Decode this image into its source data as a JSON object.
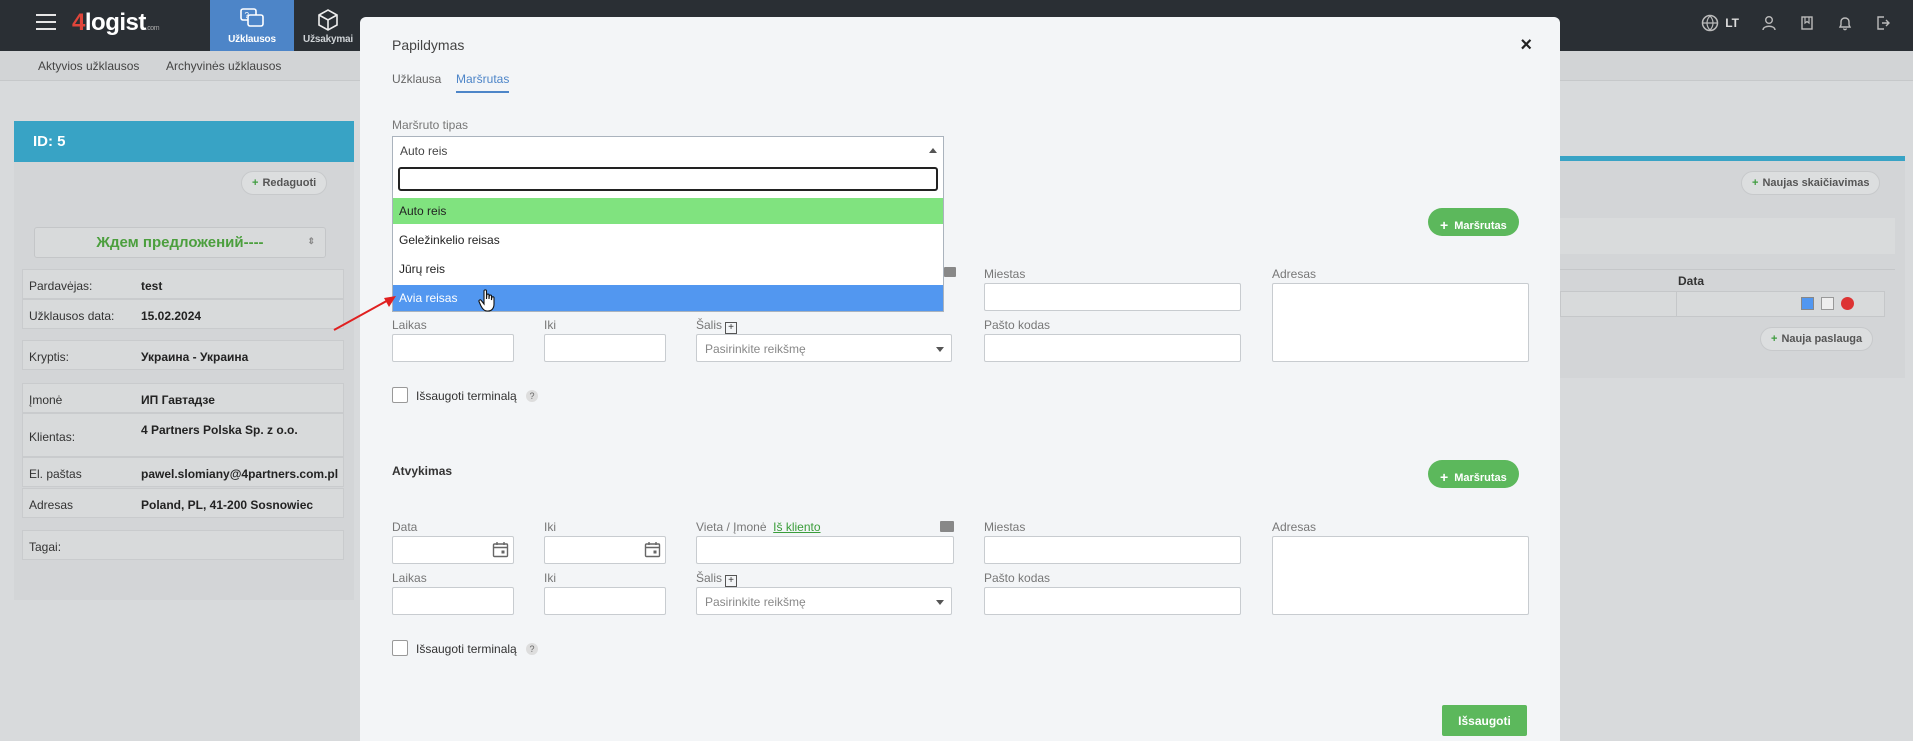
{
  "topbar": {
    "logo_prefix": "4",
    "logo_text": "logist",
    "logo_suffix": ".com",
    "nav": [
      {
        "label": "Užklausos",
        "icon": "inquiries-icon"
      },
      {
        "label": "Užsakymai",
        "icon": "orders-icon"
      }
    ],
    "lang": "LT"
  },
  "subnav": {
    "active": "Aktyvios užklausos",
    "archived": "Archyvinės užklausos"
  },
  "left": {
    "id_label": "ID: 5",
    "edit_button": "Redaguoti",
    "status": "Ждем предложений----",
    "rows": [
      {
        "k": "Pardavėjas:",
        "v": "test"
      },
      {
        "k": "Užklausos data:",
        "v": "15.02.2024"
      },
      {
        "k": "Kryptis:",
        "v": "Украина - Украина"
      },
      {
        "k": "Įmonė",
        "v": "ИП Гавтадзе"
      },
      {
        "k": "Klientas:",
        "v": "4 Partners Polska Sp. z o.o."
      },
      {
        "k": "El. paštas",
        "v": "pawel.slomiany@4partners.com.pl"
      },
      {
        "k": "Adresas",
        "v": "Poland, PL, 41-200 Sosnowiec"
      },
      {
        "k": "Tagai:",
        "v": ""
      }
    ]
  },
  "right": {
    "new_calc": "Naujas skaičiavimas",
    "col_data": "Data",
    "new_service": "Nauja paslauga"
  },
  "modal": {
    "title": "Papildymas",
    "close": "×",
    "tabs": [
      "Užklausa",
      "Maršrutas"
    ],
    "route_type_label": "Maršruto tipas",
    "route_type_value": "Auto reis",
    "route_options": [
      "Auto reis",
      "Geležinkelio reisas",
      "Jūrų reis",
      "Avia reisas"
    ],
    "route_button": "Maršrutas",
    "pickup": {
      "labels": {
        "city": "Miestas",
        "address": "Adresas",
        "time": "Laikas",
        "until": "Iki",
        "country": "Šalis",
        "postcode": "Pašto kodas"
      },
      "country_placeholder": "Pasirinkite reikšmę",
      "save_terminal": "Išsaugoti terminalą"
    },
    "delivery": {
      "title": "Atvykimas",
      "labels": {
        "date": "Data",
        "until": "Iki",
        "place": "Vieta / Įmonė",
        "from_client": "Iš kliento",
        "city": "Miestas",
        "address": "Adresas",
        "time": "Laikas",
        "until2": "Iki",
        "country": "Šalis",
        "postcode": "Pašto kodas"
      },
      "country_placeholder": "Pasirinkite reikšmę",
      "save_terminal": "Išsaugoti terminalą"
    },
    "save": "Išsaugoti"
  },
  "colors": {
    "accent": "#4d85c8",
    "green": "#5cb85c",
    "highlight": "#80e37f",
    "selected": "#5297f0",
    "teal": "#38a3c5"
  }
}
